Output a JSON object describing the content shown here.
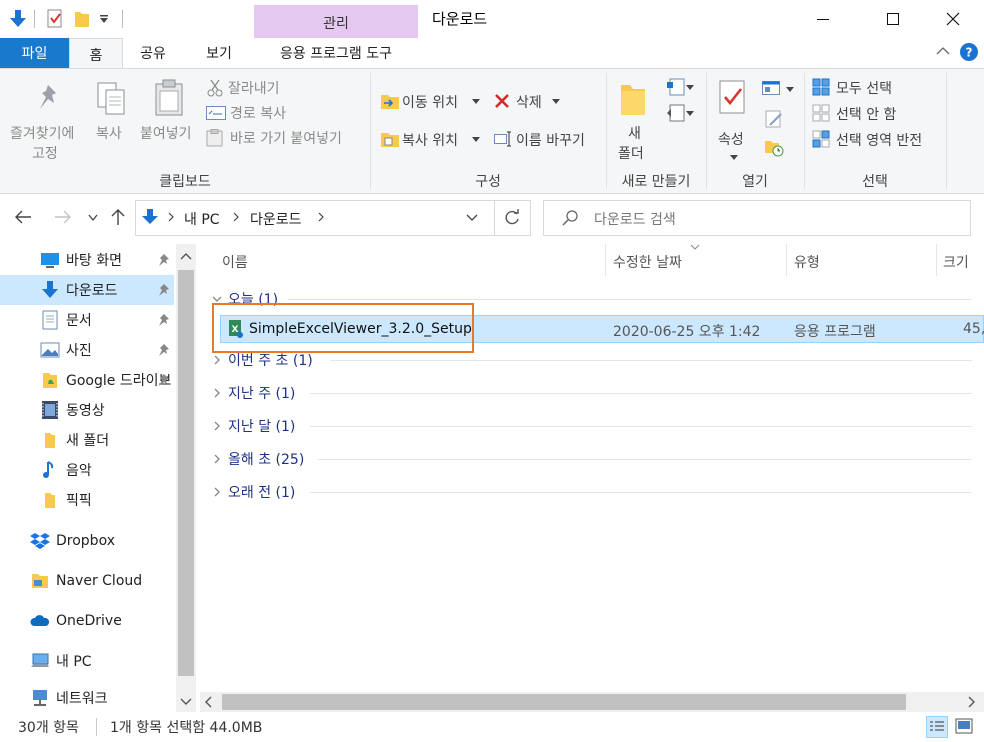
{
  "window": {
    "title": "다운로드",
    "contextual_tab_header": "관리"
  },
  "ribbon_tabs": {
    "file": "파일",
    "home": "홈",
    "share": "공유",
    "view": "보기",
    "app_tools": "응용 프로그램 도구"
  },
  "ribbon": {
    "clipboard": {
      "pin_line1": "즐겨찾기에",
      "pin_line2": "고정",
      "copy": "복사",
      "paste": "붙여넣기",
      "cut": "잘라내기",
      "copy_path": "경로 복사",
      "paste_shortcut": "바로 가기 붙여넣기",
      "group_label": "클립보드"
    },
    "organize": {
      "move_to": "이동 위치",
      "copy_to": "복사 위치",
      "delete": "삭제",
      "rename": "이름 바꾸기",
      "group_label": "구성"
    },
    "new": {
      "new_folder_line1": "새",
      "new_folder_line2": "폴더",
      "group_label": "새로 만들기"
    },
    "open": {
      "properties": "속성",
      "group_label": "열기"
    },
    "select": {
      "select_all": "모두 선택",
      "select_none": "선택 안 함",
      "invert": "선택 영역 반전",
      "group_label": "선택"
    }
  },
  "address": {
    "crumbs": [
      "내 PC",
      "다운로드"
    ],
    "search_placeholder": "다운로드 검색"
  },
  "nav": {
    "quick_access": [
      {
        "label": "바탕 화면",
        "pinned": true
      },
      {
        "label": "다운로드",
        "pinned": true
      },
      {
        "label": "문서",
        "pinned": true
      },
      {
        "label": "사진",
        "pinned": true
      },
      {
        "label": "Google 드라이브",
        "pinned": true
      },
      {
        "label": "동영상",
        "pinned": false
      },
      {
        "label": "새 폴더",
        "pinned": false
      },
      {
        "label": "음악",
        "pinned": false
      },
      {
        "label": "픽픽",
        "pinned": false
      }
    ],
    "roots": [
      {
        "label": "Dropbox"
      },
      {
        "label": "Naver Cloud"
      },
      {
        "label": "OneDrive"
      },
      {
        "label": "내 PC"
      },
      {
        "label": "네트워크"
      }
    ]
  },
  "columns": {
    "name": "이름",
    "date": "수정한 날짜",
    "type": "유형",
    "size": "크기"
  },
  "groups": [
    {
      "label": "오늘 (1)",
      "expanded": true
    },
    {
      "label": "이번 주 초 (1)",
      "expanded": false
    },
    {
      "label": "지난 주 (1)",
      "expanded": false
    },
    {
      "label": "지난 달 (1)",
      "expanded": false
    },
    {
      "label": "올해 초 (25)",
      "expanded": false
    },
    {
      "label": "오래 전 (1)",
      "expanded": false
    }
  ],
  "file": {
    "name": "SimpleExcelViewer_3.2.0_Setup",
    "date": "2020-06-25 오후 1:42",
    "type": "응용 프로그램",
    "size": "45,"
  },
  "status": {
    "item_count": "30개 항목",
    "selection": "1개 항목 선택함 44.0MB"
  },
  "colors": {
    "accent": "#1979ca",
    "selection": "#cce8ff",
    "contextual": "#e4c8f0",
    "highlight_box": "#e87a2a"
  }
}
